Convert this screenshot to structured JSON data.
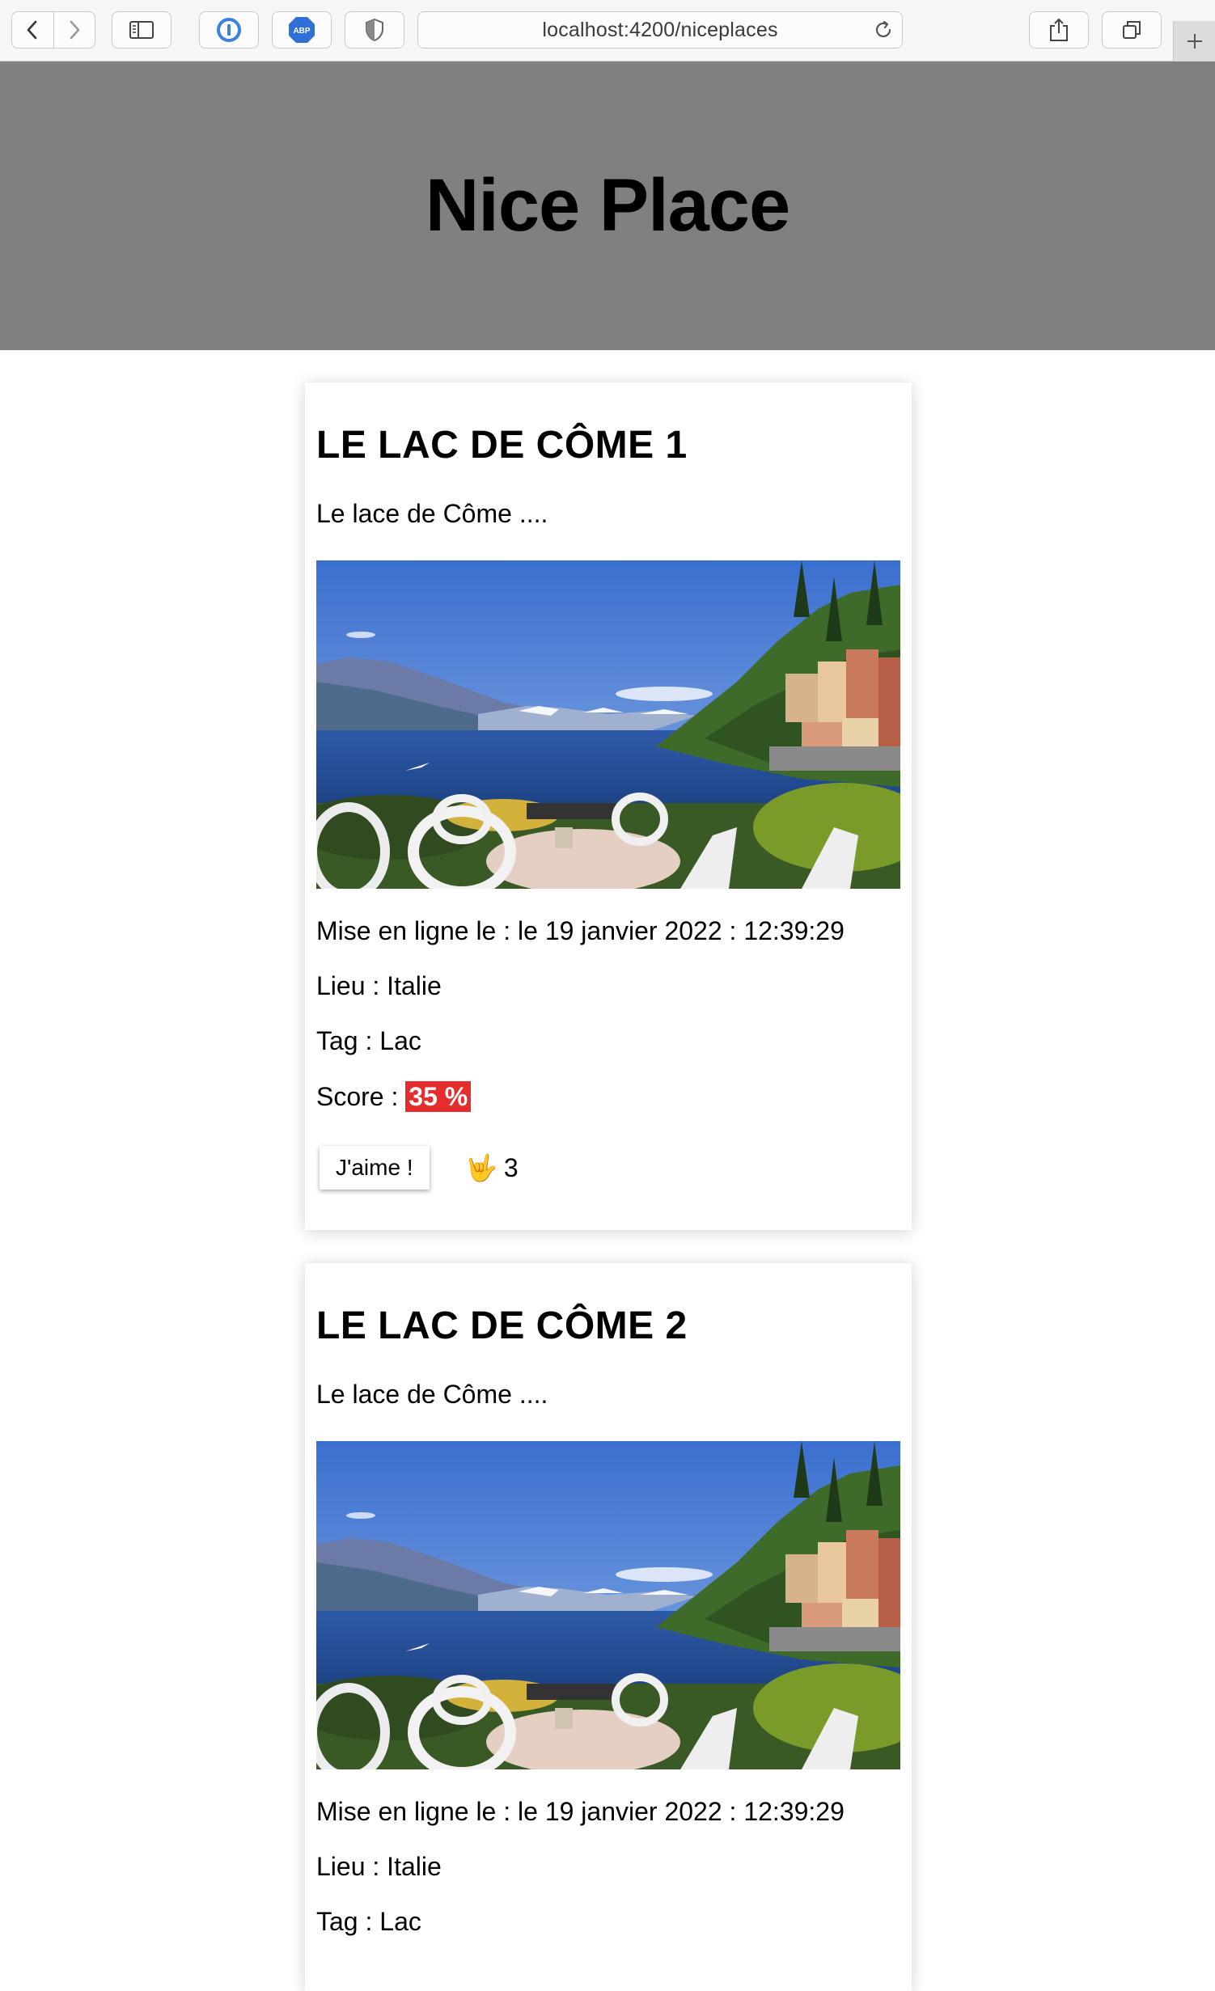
{
  "browser": {
    "url": "localhost:4200/niceplaces",
    "icons": [
      "back-icon",
      "forward-icon",
      "sidebar-icon",
      "password-manager-icon",
      "adblock-icon",
      "privacy-shield-icon",
      "reload-icon",
      "share-icon",
      "tabs-icon",
      "new-tab-icon"
    ],
    "adblock_label": "ABP"
  },
  "header": {
    "title": "Nice Place"
  },
  "places": [
    {
      "title": "LE LAC DE CÔME 1",
      "description": "Le lace de Côme ....",
      "date_label": "Mise en ligne le :",
      "date_value": "le 19 janvier 2022 : 12:39:29",
      "location_label": "Lieu :",
      "location_value": "Italie",
      "tag_label": "Tag :",
      "tag_value": "Lac",
      "score_label": "Score :",
      "score_value": "35 %",
      "like_button": "J'aime !",
      "like_emoji": "🤟",
      "like_count": "3"
    },
    {
      "title": "LE LAC DE CÔME 2",
      "description": "Le lace de Côme ....",
      "date_label": "Mise en ligne le :",
      "date_value": "le 19 janvier 2022 : 12:39:29",
      "location_label": "Lieu :",
      "location_value": "Italie",
      "tag_label": "Tag :",
      "tag_value": "Lac"
    }
  ],
  "colors": {
    "header_bg": "#808080",
    "score_badge": "#e52d2d"
  }
}
